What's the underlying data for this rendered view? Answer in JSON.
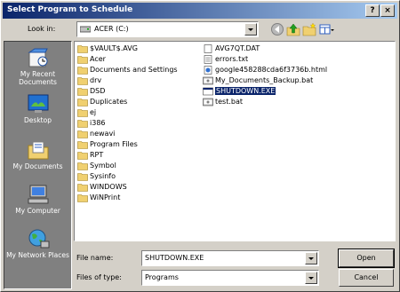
{
  "window": {
    "title": "Select Program to Schedule",
    "help_btn": "?",
    "close_btn": "×"
  },
  "lookin": {
    "label": "Look in:",
    "value": "ACER (C:)"
  },
  "toolbar": {
    "icons": [
      "back-icon",
      "up-folder-icon",
      "new-folder-icon",
      "views-menu-icon"
    ]
  },
  "places": [
    {
      "label": "My Recent Documents",
      "icon": "recent-documents-icon"
    },
    {
      "label": "Desktop",
      "icon": "desktop-icon"
    },
    {
      "label": "My Documents",
      "icon": "my-documents-icon"
    },
    {
      "label": "My Computer",
      "icon": "my-computer-icon"
    },
    {
      "label": "My Network Places",
      "icon": "network-places-icon"
    }
  ],
  "files": {
    "col1": [
      {
        "name": "$VAULT$.AVG",
        "icon": "folder-icon"
      },
      {
        "name": "Acer",
        "icon": "folder-icon"
      },
      {
        "name": "Documents and Settings",
        "icon": "folder-icon"
      },
      {
        "name": "drv",
        "icon": "folder-icon"
      },
      {
        "name": "DSD",
        "icon": "folder-icon"
      },
      {
        "name": "Duplicates",
        "icon": "folder-icon"
      },
      {
        "name": "ej",
        "icon": "folder-icon"
      },
      {
        "name": "i386",
        "icon": "folder-icon"
      },
      {
        "name": "newavi",
        "icon": "folder-icon"
      },
      {
        "name": "Program Files",
        "icon": "folder-icon"
      },
      {
        "name": "RPT",
        "icon": "folder-icon"
      },
      {
        "name": "Symbol",
        "icon": "folder-icon"
      },
      {
        "name": "Sysinfo",
        "icon": "folder-icon"
      },
      {
        "name": "WINDOWS",
        "icon": "folder-icon"
      },
      {
        "name": "WiNPrint",
        "icon": "folder-icon"
      }
    ],
    "col2": [
      {
        "name": "AVG7QT.DAT",
        "icon": "file-icon"
      },
      {
        "name": "errors.txt",
        "icon": "text-file-icon"
      },
      {
        "name": "google458288cda6f3736b.html",
        "icon": "html-file-icon"
      },
      {
        "name": "My_Documents_Backup.bat",
        "icon": "batch-file-icon"
      },
      {
        "name": "SHUTDOWN.EXE",
        "icon": "exe-file-icon",
        "selected": true
      },
      {
        "name": "test.bat",
        "icon": "batch-file-icon"
      }
    ]
  },
  "form": {
    "filename_label": "File name:",
    "filename_value": "SHUTDOWN.EXE",
    "filetype_label": "Files of type:",
    "filetype_value": "Programs",
    "open_label": "Open",
    "cancel_label": "Cancel"
  }
}
